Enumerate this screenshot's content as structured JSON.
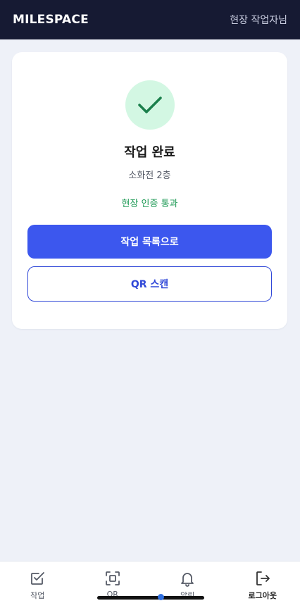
{
  "header": {
    "logo": "MILESPACE",
    "user_label": "현장 작업자님"
  },
  "completion": {
    "title": "작업 완료",
    "location": "소화전 2층",
    "status": "현장 인증 통과"
  },
  "buttons": {
    "primary": "작업 목록으로",
    "secondary": "QR 스캔"
  },
  "nav": {
    "items": [
      {
        "label": "작업",
        "icon": "checkbox-icon"
      },
      {
        "label": "QR",
        "icon": "qr-scan-icon"
      },
      {
        "label": "알림",
        "icon": "bell-icon"
      },
      {
        "label": "로그아웃",
        "icon": "logout-icon"
      }
    ]
  },
  "colors": {
    "header_bg": "#161a33",
    "primary": "#3c57ee",
    "success": "#1e9a55",
    "success_bg": "#d3f7e3",
    "page_bg": "#eef1f8"
  }
}
